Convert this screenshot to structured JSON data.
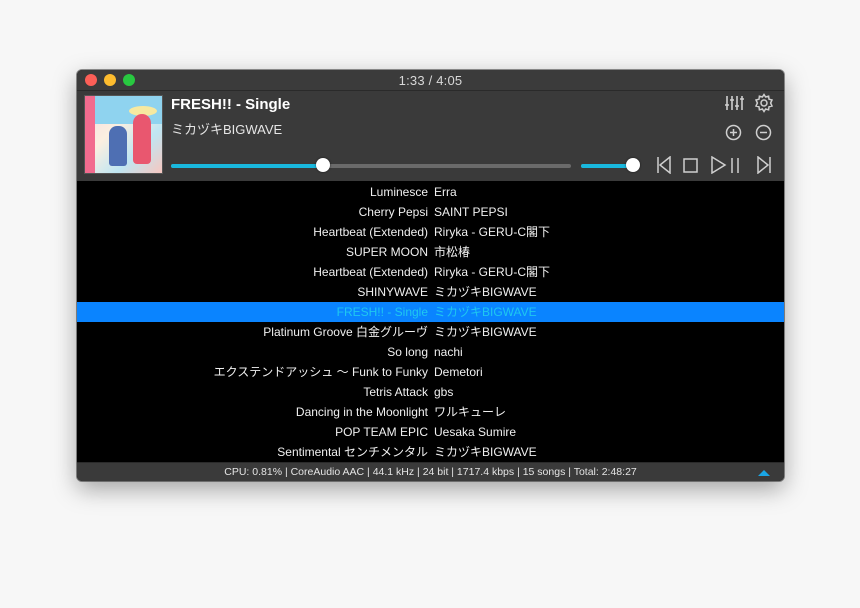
{
  "window": {
    "title": "1:33 / 4:05"
  },
  "now_playing": {
    "title": "FRESH!! - Single",
    "artist": "ミカヅキBIGWAVE",
    "progress_fraction": 0.38,
    "volume_fraction": 0.92,
    "accent_color": "#19b8de"
  },
  "toolbar": {
    "icons": [
      "equalizer-icon",
      "gear-icon",
      "add-icon",
      "remove-icon",
      "previous-icon",
      "stop-icon",
      "play-pause-icon",
      "next-icon"
    ]
  },
  "playlist": {
    "selected_index": 6,
    "rows": [
      {
        "title": "Luminesce",
        "artist": "Erra"
      },
      {
        "title": "Cherry Pepsi",
        "artist": "SAINT PEPSI"
      },
      {
        "title": "Heartbeat (Extended)",
        "artist": "Riryka - GERU-C閣下"
      },
      {
        "title": "SUPER MOON",
        "artist": "市松椿"
      },
      {
        "title": "Heartbeat (Extended)",
        "artist": "Riryka - GERU-C閣下"
      },
      {
        "title": "SHINYWAVE",
        "artist": "ミカヅキBIGWAVE"
      },
      {
        "title": "FRESH!! - Single",
        "artist": "ミカヅキBIGWAVE"
      },
      {
        "title": "Platinum Groove 白金グルーヴ",
        "artist": "ミカヅキBIGWAVE"
      },
      {
        "title": "So long",
        "artist": "nachi"
      },
      {
        "title": "エクステンドアッシュ 〜 Funk to Funky",
        "artist": "Demetori"
      },
      {
        "title": "Tetris Attack",
        "artist": "gbs"
      },
      {
        "title": "Dancing in the Moonlight",
        "artist": "ワルキューレ"
      },
      {
        "title": "POP TEAM EPIC",
        "artist": "Uesaka Sumire"
      },
      {
        "title": "Sentimental センチメンタル",
        "artist": "ミカヅキBIGWAVE"
      }
    ]
  },
  "status": {
    "text": "CPU: 0.81% | CoreAudio AAC | 44.1 kHz | 24 bit | 1717.4 kbps | 15 songs | Total: 2:48:27"
  }
}
